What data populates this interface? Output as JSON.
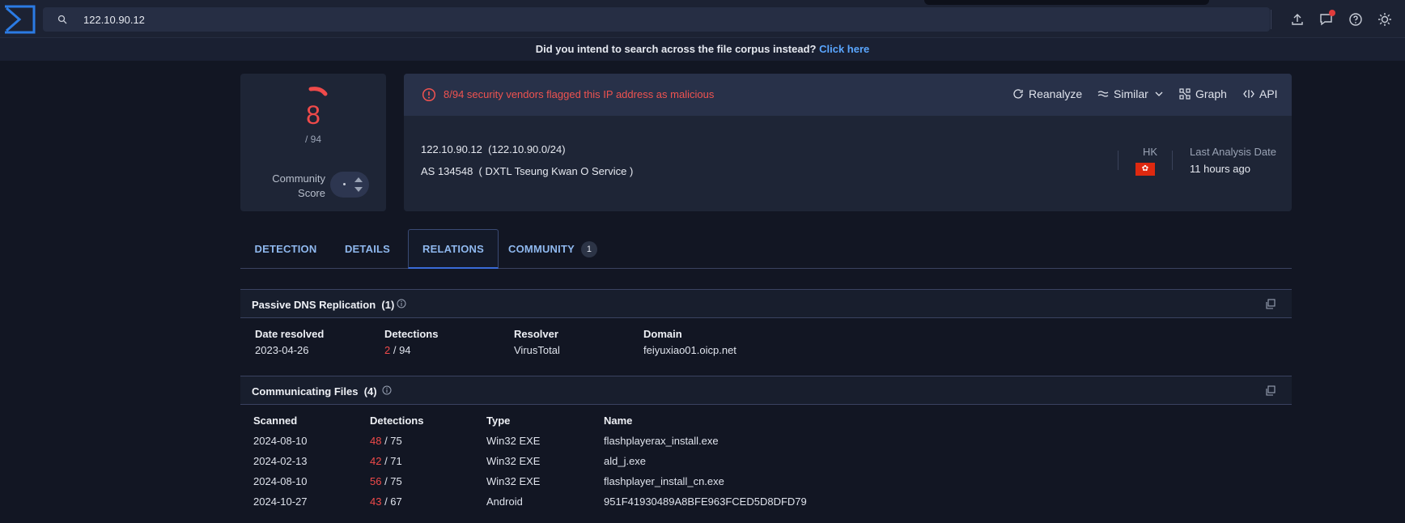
{
  "search": {
    "query": "122.10.90.12"
  },
  "notice": {
    "text": "Did you intend to search across the file corpus instead?",
    "link": "Click here"
  },
  "score": {
    "value": "8",
    "total": "/ 94",
    "community_label_1": "Community",
    "community_label_2": "Score",
    "community_value": "."
  },
  "alert": {
    "text": "8/94 security vendors flagged this IP address as malicious"
  },
  "actions": {
    "reanalyze": "Reanalyze",
    "similar": "Similar",
    "graph": "Graph",
    "api": "API"
  },
  "ip": {
    "line": "122.10.90.12  (122.10.90.0/24)",
    "as_line": "AS 134548  ( DXTL Tseung Kwan O Service )",
    "country": "HK",
    "last_analysis_label": "Last Analysis Date",
    "last_analysis_value": "11 hours ago"
  },
  "tabs": [
    {
      "label": "DETECTION"
    },
    {
      "label": "DETAILS"
    },
    {
      "label": "RELATIONS"
    },
    {
      "label": "COMMUNITY",
      "badge": "1"
    }
  ],
  "passive_dns": {
    "title": "Passive DNS Replication",
    "count": "(1)",
    "columns": [
      "Date resolved",
      "Detections",
      "Resolver",
      "Domain"
    ],
    "rows": [
      {
        "date": "2023-04-26",
        "det": "2",
        "det_total": " / 94",
        "resolver": "VirusTotal",
        "domain": "feiyuxiao01.oicp.net"
      }
    ]
  },
  "comm_files": {
    "title": "Communicating Files",
    "count": "(4)",
    "columns": [
      "Scanned",
      "Detections",
      "Type",
      "Name"
    ],
    "rows": [
      {
        "scanned": "2024-08-10",
        "det": "48",
        "det_total": " / 75",
        "type": "Win32 EXE",
        "name": "flashplayerax_install.exe"
      },
      {
        "scanned": "2024-02-13",
        "det": "42",
        "det_total": " / 71",
        "type": "Win32 EXE",
        "name": "ald_j.exe"
      },
      {
        "scanned": "2024-08-10",
        "det": "56",
        "det_total": " / 75",
        "type": "Win32 EXE",
        "name": "flashplayer_install_cn.exe"
      },
      {
        "scanned": "2024-10-27",
        "det": "43",
        "det_total": " / 67",
        "type": "Android",
        "name": "951F41930489A8BFE963FCED5D8DFD79"
      }
    ]
  },
  "colors": {
    "malicious": "#ef4a4a",
    "link": "#5aa6ff",
    "accent": "#3a6bd8"
  },
  "icons": [
    "logo-icon",
    "search-icon",
    "upload-icon",
    "chat-icon",
    "help-icon",
    "theme-icon",
    "alert-icon",
    "refresh-icon",
    "similar-icon",
    "graph-icon",
    "api-icon",
    "chevron-down-icon",
    "info-icon",
    "copy-icon"
  ]
}
